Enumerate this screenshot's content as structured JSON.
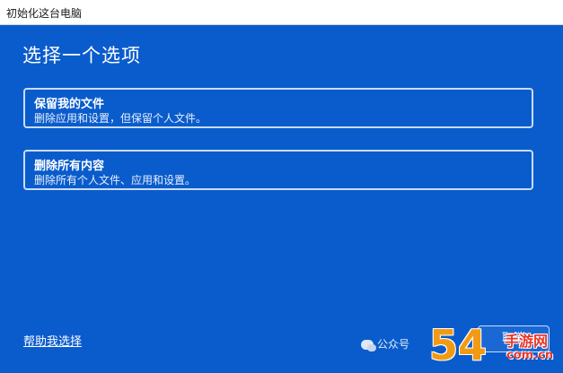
{
  "window": {
    "title": "初始化这台电脑"
  },
  "dialog": {
    "heading": "选择一个选项",
    "options": [
      {
        "title": "保留我的文件",
        "description": "删除应用和设置，但保留个人文件。"
      },
      {
        "title": "删除所有内容",
        "description": "删除所有个人文件、应用和设置。"
      }
    ],
    "help_link": "帮助我选择",
    "cancel_label": "取消"
  },
  "watermark": {
    "wechat_text": "公众号",
    "logo_main": "54",
    "logo_cn": "手游网",
    "logo_domain": "com.cn"
  },
  "colors": {
    "panel_bg": "#0a5ccc",
    "option_border": "#c9ddf8",
    "logo_orange": "#f29a14",
    "logo_red": "#e8362a"
  }
}
